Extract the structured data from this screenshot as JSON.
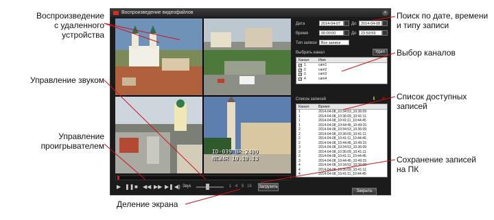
{
  "annotations": {
    "remote_playback": [
      "Воспроизведение",
      "с удаленного устройства"
    ],
    "sound_control": [
      "Управление звуком"
    ],
    "player_control": [
      "Управление",
      "проигрывателем"
    ],
    "screen_split": [
      "Деление экрана"
    ],
    "search": [
      "Поиск по дате, времени",
      "и типу записи"
    ],
    "channel_select": [
      "Выбор каналов"
    ],
    "record_list": [
      "Список доступных",
      "записей"
    ],
    "save_to_pc": [
      "Сохранение записей",
      "на ПК"
    ]
  },
  "window": {
    "title": "Воспроизведение видеофайлов",
    "close_glyph": "×"
  },
  "video": {
    "osd_line1": "ID-039   BR:2400",
    "osd_line2": "NEW4R 10.10.13"
  },
  "controls": {
    "play": "▶",
    "pause": "❚❚",
    "stop": "■",
    "prev": "◀◀",
    "next": "▶▶",
    "step": "▶❚",
    "sound_label": "Звук",
    "split_labels": [
      "1",
      "4",
      "9",
      "16"
    ],
    "download_label": "Загрузить",
    "close_label": "Закрыть"
  },
  "search": {
    "date_label": "Дата",
    "date_from": "2014-04-07",
    "to_label": "До",
    "date_to": "2014-04-08",
    "time_label": "Время",
    "time_from": "00:00:00",
    "time_to": "23:59:59",
    "type_label": "Тип записи",
    "type_value": "Все записи"
  },
  "channels": {
    "section_label": "Выбрать канал",
    "all_button": "Удал",
    "col_channel": "Канал",
    "col_name": "Имя",
    "rows": [
      {
        "num": "1",
        "name": "cam1",
        "checked": "✓"
      },
      {
        "num": "2",
        "name": "cam2",
        "checked": "✓"
      },
      {
        "num": "3",
        "name": "cam3",
        "checked": "✓"
      },
      {
        "num": "4",
        "name": "cam4",
        "checked": "✓"
      }
    ]
  },
  "records": {
    "section_label": "Список записей",
    "col_channel": "Канал",
    "col_time": "Время",
    "rows": [
      {
        "ch": "1",
        "time": "2014-04-08_10:34:53_10:36:09"
      },
      {
        "ch": "1",
        "time": "2014-04-08_10:36:09_10:41:11"
      },
      {
        "ch": "1",
        "time": "2014-04-08_10:41:11_10:44:45"
      },
      {
        "ch": "1",
        "time": "2014-04-08_10:44:45_10:49:15"
      },
      {
        "ch": "2",
        "time": "2014-04-08_10:34:53_10:36:09"
      },
      {
        "ch": "2",
        "time": "2014-04-08_10:36:09_10:41:11"
      },
      {
        "ch": "2",
        "time": "2014-04-08_10:41:11_10:44:45"
      },
      {
        "ch": "2",
        "time": "2014-04-08_10:44:45_10:49:15"
      },
      {
        "ch": "3",
        "time": "2014-04-08_10:34:53_10:36:09"
      },
      {
        "ch": "3",
        "time": "2014-04-08_10:36:09_10:41:11"
      },
      {
        "ch": "3",
        "time": "2014-04-08_10:41:11_10:44:45"
      },
      {
        "ch": "3",
        "time": "2014-04-08_10:44:45_10:49:15"
      },
      {
        "ch": "4",
        "time": "2014-04-08_10:34:53_10:36:09"
      },
      {
        "ch": "4",
        "time": "2014-04-08_10:36:09_10:41:11"
      },
      {
        "ch": "4",
        "time": "2014-04-08_10:41:11_10:44:45"
      },
      {
        "ch": "4",
        "time": "2014-04-08_10:44:45_10:49:15"
      }
    ]
  },
  "colors": {
    "window_bg": "#1b1b1b",
    "accent_red": "#c23a2a",
    "leader_line": "#d0101b",
    "selection_green": "#8fbf3f"
  },
  "icons": [
    "app-icon",
    "close-icon",
    "calendar-icon",
    "download-icon",
    "delete-icon",
    "volume-icon"
  ]
}
